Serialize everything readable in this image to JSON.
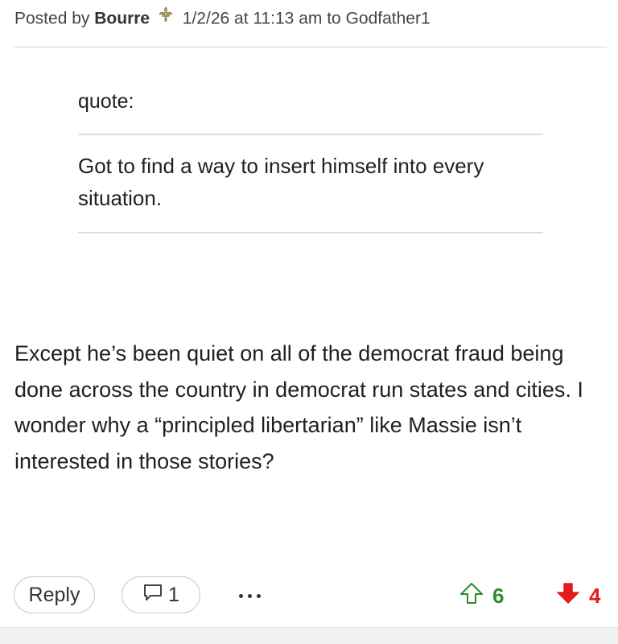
{
  "post": {
    "posted_by_prefix": "Posted by",
    "author": "Bourre",
    "timestamp": "1/2/26 at 11:13 am",
    "to_prefix": "to",
    "reply_to": "Godfather1",
    "author_badge_icon": "fleur-de-lis-icon"
  },
  "quote": {
    "label": "quote:",
    "text": "Got to find a way to insert himself into every situation."
  },
  "body": "Except he’s been quiet on all of the democrat fraud being done across the country in democrat run states and cities. I wonder why a “principled libertarian” like Massie isn’t interested in those stories?",
  "actions": {
    "reply_label": "Reply",
    "comment_count": "1",
    "comment_icon": "speech-bubble-icon",
    "more_icon": "ellipsis-icon",
    "upvotes": "6",
    "upvote_icon": "arrow-up-outline-icon",
    "downvotes": "4",
    "downvote_icon": "arrow-down-filled-icon"
  },
  "colors": {
    "upvote": "#2e8b2e",
    "downvote": "#e41b1b",
    "badge": "#b8a16a"
  }
}
